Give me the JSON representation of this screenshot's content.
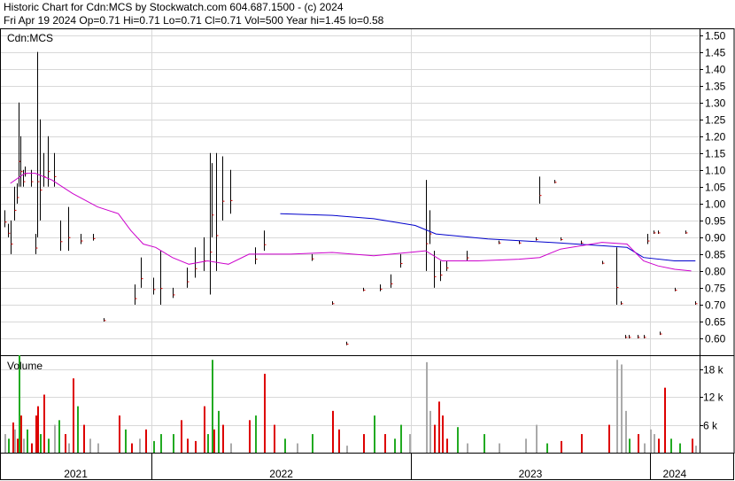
{
  "header": {
    "line1": "Historic Chart for Cdn:MCS by Stockwatch.com 604.687.1500 - (c) 2024",
    "line2": "Fri Apr 19 2024  Op=0.71  Hi=0.71  Lo=0.71  Cl=0.71  Vol=500  Year hi=1.45  lo=0.58"
  },
  "chart_data": {
    "type": "line",
    "price_panel": {
      "title": "Cdn:MCS",
      "ylim": [
        0.55,
        1.52
      ],
      "y_ticks": [
        "1.50",
        "1.45",
        "1.40",
        "1.35",
        "1.30",
        "1.25",
        "1.20",
        "1.15",
        "1.10",
        "1.05",
        "1.00",
        "0.95",
        "0.90",
        "0.85",
        "0.80",
        "0.75",
        "0.70",
        "0.65",
        "0.60"
      ],
      "y_tick_values": [
        1.5,
        1.45,
        1.4,
        1.35,
        1.3,
        1.25,
        1.2,
        1.15,
        1.1,
        1.05,
        1.0,
        0.95,
        0.9,
        0.85,
        0.8,
        0.75,
        0.7,
        0.65,
        0.6
      ],
      "ma_long": {
        "color": "#0000cc",
        "points": [
          [
            2022.3,
            0.97
          ],
          [
            2022.55,
            0.965
          ],
          [
            2022.75,
            0.955
          ],
          [
            2022.95,
            0.935
          ],
          [
            2023.05,
            0.91
          ],
          [
            2023.3,
            0.895
          ],
          [
            2023.6,
            0.885
          ],
          [
            2023.85,
            0.875
          ],
          [
            2023.97,
            0.87
          ],
          [
            2024.05,
            0.84
          ],
          [
            2024.2,
            0.83
          ],
          [
            2024.3,
            0.83
          ]
        ]
      },
      "ma_short": {
        "color": "#cc00cc",
        "points": [
          [
            2021.0,
            1.06
          ],
          [
            2021.07,
            1.09
          ],
          [
            2021.12,
            1.09
          ],
          [
            2021.2,
            1.07
          ],
          [
            2021.3,
            1.03
          ],
          [
            2021.42,
            0.99
          ],
          [
            2021.52,
            0.97
          ],
          [
            2021.58,
            0.92
          ],
          [
            2021.64,
            0.88
          ],
          [
            2021.7,
            0.87
          ],
          [
            2021.78,
            0.84
          ],
          [
            2021.86,
            0.82
          ],
          [
            2021.95,
            0.83
          ],
          [
            2022.05,
            0.82
          ],
          [
            2022.15,
            0.85
          ],
          [
            2022.35,
            0.85
          ],
          [
            2022.55,
            0.855
          ],
          [
            2022.75,
            0.845
          ],
          [
            2022.92,
            0.855
          ],
          [
            2023.0,
            0.86
          ],
          [
            2023.08,
            0.83
          ],
          [
            2023.25,
            0.83
          ],
          [
            2023.45,
            0.835
          ],
          [
            2023.55,
            0.84
          ],
          [
            2023.65,
            0.865
          ],
          [
            2023.85,
            0.885
          ],
          [
            2023.97,
            0.88
          ],
          [
            2024.05,
            0.83
          ],
          [
            2024.12,
            0.815
          ],
          [
            2024.2,
            0.805
          ],
          [
            2024.28,
            0.8
          ]
        ]
      },
      "bars": [
        [
          2020.97,
          0.93,
          0.98
        ],
        [
          2020.99,
          0.9,
          0.94
        ],
        [
          2021.0,
          0.85,
          0.95
        ],
        [
          2021.02,
          0.95,
          1.05
        ],
        [
          2021.03,
          1.0,
          1.06
        ],
        [
          2021.04,
          1.05,
          1.3
        ],
        [
          2021.05,
          1.05,
          1.2
        ],
        [
          2021.06,
          1.05,
          1.1
        ],
        [
          2021.07,
          1.08,
          1.11
        ],
        [
          2021.1,
          1.05,
          1.1
        ],
        [
          2021.12,
          0.85,
          0.91
        ],
        [
          2021.13,
          0.9,
          1.45
        ],
        [
          2021.14,
          0.95,
          1.25
        ],
        [
          2021.16,
          1.05,
          1.15
        ],
        [
          2021.18,
          1.05,
          1.2
        ],
        [
          2021.21,
          1.05,
          1.15
        ],
        [
          2021.24,
          0.86,
          0.95
        ],
        [
          2021.28,
          0.86,
          0.99
        ],
        [
          2021.34,
          0.88,
          0.91
        ],
        [
          2021.4,
          0.89,
          0.91
        ],
        [
          2021.45,
          0.65,
          0.66
        ],
        [
          2021.6,
          0.7,
          0.76
        ],
        [
          2021.63,
          0.75,
          0.84
        ],
        [
          2021.69,
          0.73,
          0.78
        ],
        [
          2021.72,
          0.7,
          0.86
        ],
        [
          2021.78,
          0.72,
          0.75
        ],
        [
          2021.85,
          0.75,
          0.81
        ],
        [
          2021.89,
          0.78,
          0.87
        ],
        [
          2021.93,
          0.8,
          0.9
        ],
        [
          2021.96,
          0.73,
          1.15
        ],
        [
          2021.97,
          0.9,
          1.12
        ],
        [
          2021.99,
          0.8,
          1.15
        ],
        [
          2022.02,
          0.95,
          1.14
        ],
        [
          2022.06,
          0.97,
          1.1
        ],
        [
          2022.18,
          0.82,
          0.87
        ],
        [
          2022.22,
          0.86,
          0.92
        ],
        [
          2022.45,
          0.83,
          0.85
        ],
        [
          2022.55,
          0.7,
          0.71
        ],
        [
          2022.62,
          0.58,
          0.59
        ],
        [
          2022.7,
          0.74,
          0.75
        ],
        [
          2022.78,
          0.74,
          0.76
        ],
        [
          2022.83,
          0.75,
          0.79
        ],
        [
          2022.88,
          0.81,
          0.85
        ],
        [
          2023.0,
          0.8,
          1.07
        ],
        [
          2023.02,
          0.88,
          0.98
        ],
        [
          2023.04,
          0.75,
          0.86
        ],
        [
          2023.07,
          0.77,
          0.83
        ],
        [
          2023.1,
          0.8,
          0.83
        ],
        [
          2023.2,
          0.83,
          0.86
        ],
        [
          2023.35,
          0.88,
          0.89
        ],
        [
          2023.45,
          0.88,
          0.89
        ],
        [
          2023.53,
          0.89,
          0.9
        ],
        [
          2023.55,
          1.0,
          1.08
        ],
        [
          2023.62,
          1.06,
          1.07
        ],
        [
          2023.65,
          0.89,
          0.9
        ],
        [
          2023.75,
          0.88,
          0.89
        ],
        [
          2023.85,
          0.82,
          0.83
        ],
        [
          2023.92,
          0.7,
          0.87
        ],
        [
          2023.94,
          0.7,
          0.71
        ],
        [
          2023.96,
          0.6,
          0.61
        ],
        [
          2023.98,
          0.6,
          0.61
        ],
        [
          2024.02,
          0.6,
          0.61
        ],
        [
          2024.05,
          0.6,
          0.61
        ],
        [
          2024.07,
          0.88,
          0.91
        ],
        [
          2024.1,
          0.91,
          0.92
        ],
        [
          2024.12,
          0.91,
          0.92
        ],
        [
          2024.13,
          0.61,
          0.62
        ],
        [
          2024.2,
          0.74,
          0.75
        ],
        [
          2024.25,
          0.91,
          0.92
        ],
        [
          2024.3,
          0.7,
          0.71
        ]
      ]
    },
    "volume_panel": {
      "title": "Volume",
      "ylim": [
        0,
        21000
      ],
      "y_ticks": [
        "18 k",
        "12 k",
        "6 k"
      ],
      "y_tick_values": [
        18000,
        12000,
        6000
      ],
      "bars": [
        [
          2020.97,
          4000,
          "gray"
        ],
        [
          2020.99,
          3000,
          "green"
        ],
        [
          2021.01,
          6500,
          "red"
        ],
        [
          2021.02,
          5000,
          "gray"
        ],
        [
          2021.03,
          3000,
          "red"
        ],
        [
          2021.04,
          21000,
          "green"
        ],
        [
          2021.05,
          8000,
          "red"
        ],
        [
          2021.06,
          3000,
          "gray"
        ],
        [
          2021.08,
          5000,
          "green"
        ],
        [
          2021.1,
          2000,
          "red"
        ],
        [
          2021.12,
          8000,
          "red"
        ],
        [
          2021.13,
          10000,
          "red"
        ],
        [
          2021.14,
          4000,
          "green"
        ],
        [
          2021.16,
          12500,
          "red"
        ],
        [
          2021.18,
          3000,
          "green"
        ],
        [
          2021.21,
          6000,
          "gray"
        ],
        [
          2021.23,
          7000,
          "green"
        ],
        [
          2021.26,
          4000,
          "red"
        ],
        [
          2021.28,
          2000,
          "gray"
        ],
        [
          2021.3,
          16000,
          "red"
        ],
        [
          2021.32,
          10000,
          "green"
        ],
        [
          2021.35,
          6000,
          "red"
        ],
        [
          2021.38,
          3000,
          "gray"
        ],
        [
          2021.42,
          2000,
          "gray"
        ],
        [
          2021.52,
          8000,
          "red"
        ],
        [
          2021.55,
          5000,
          "green"
        ],
        [
          2021.58,
          2000,
          "red"
        ],
        [
          2021.62,
          3000,
          "gray"
        ],
        [
          2021.65,
          5000,
          "red"
        ],
        [
          2021.69,
          2500,
          "green"
        ],
        [
          2021.72,
          4000,
          "green"
        ],
        [
          2021.78,
          4000,
          "green"
        ],
        [
          2021.82,
          7000,
          "red"
        ],
        [
          2021.85,
          3000,
          "red"
        ],
        [
          2021.89,
          2500,
          "red"
        ],
        [
          2021.93,
          10000,
          "red"
        ],
        [
          2021.95,
          4000,
          "green"
        ],
        [
          2021.97,
          20000,
          "green"
        ],
        [
          2021.98,
          5000,
          "red"
        ],
        [
          2022.0,
          9000,
          "green"
        ],
        [
          2022.02,
          6000,
          "red"
        ],
        [
          2022.06,
          2000,
          "gray"
        ],
        [
          2022.15,
          7000,
          "red"
        ],
        [
          2022.18,
          8000,
          "green"
        ],
        [
          2022.22,
          17000,
          "red"
        ],
        [
          2022.27,
          6000,
          "red"
        ],
        [
          2022.32,
          3000,
          "green"
        ],
        [
          2022.38,
          2000,
          "gray"
        ],
        [
          2022.45,
          4000,
          "green"
        ],
        [
          2022.55,
          9000,
          "red"
        ],
        [
          2022.58,
          5000,
          "red"
        ],
        [
          2022.62,
          1500,
          "gray"
        ],
        [
          2022.7,
          4000,
          "red"
        ],
        [
          2022.75,
          8000,
          "green"
        ],
        [
          2022.8,
          4000,
          "red"
        ],
        [
          2022.85,
          3000,
          "green"
        ],
        [
          2022.88,
          6000,
          "green"
        ],
        [
          2022.92,
          4000,
          "gray"
        ],
        [
          2023.0,
          19500,
          "gray"
        ],
        [
          2023.02,
          9000,
          "gray"
        ],
        [
          2023.04,
          6000,
          "red"
        ],
        [
          2023.06,
          11000,
          "red"
        ],
        [
          2023.08,
          8000,
          "red"
        ],
        [
          2023.1,
          3000,
          "red"
        ],
        [
          2023.15,
          5500,
          "green"
        ],
        [
          2023.2,
          2000,
          "gray"
        ],
        [
          2023.28,
          4000,
          "green"
        ],
        [
          2023.35,
          2000,
          "gray"
        ],
        [
          2023.48,
          3000,
          "gray"
        ],
        [
          2023.53,
          6000,
          "gray"
        ],
        [
          2023.58,
          2000,
          "green"
        ],
        [
          2023.65,
          2500,
          "red"
        ],
        [
          2023.75,
          4000,
          "red"
        ],
        [
          2023.88,
          6000,
          "red"
        ],
        [
          2023.92,
          20000,
          "gray"
        ],
        [
          2023.94,
          19000,
          "gray"
        ],
        [
          2023.96,
          9000,
          "gray"
        ],
        [
          2023.98,
          3000,
          "green"
        ],
        [
          2024.02,
          4000,
          "red"
        ],
        [
          2024.05,
          2000,
          "gray"
        ],
        [
          2024.08,
          5000,
          "gray"
        ],
        [
          2024.1,
          4000,
          "gray"
        ],
        [
          2024.12,
          3000,
          "red"
        ],
        [
          2024.15,
          14000,
          "red"
        ],
        [
          2024.18,
          3000,
          "green"
        ],
        [
          2024.22,
          2000,
          "green"
        ],
        [
          2024.28,
          3000,
          "red"
        ],
        [
          2024.3,
          1500,
          "gray"
        ]
      ]
    },
    "x_axis": {
      "xlim": [
        2020.95,
        2024.32
      ],
      "years": [
        {
          "label": "2021",
          "start": 2020.95,
          "end": 2021.68
        },
        {
          "label": "2022",
          "start": 2021.68,
          "end": 2022.93
        },
        {
          "label": "2023",
          "start": 2022.93,
          "end": 2024.08
        },
        {
          "label": "2024",
          "start": 2024.08,
          "end": 2024.32
        }
      ],
      "year_boundaries": [
        2021.68,
        2022.93,
        2024.08
      ]
    }
  }
}
